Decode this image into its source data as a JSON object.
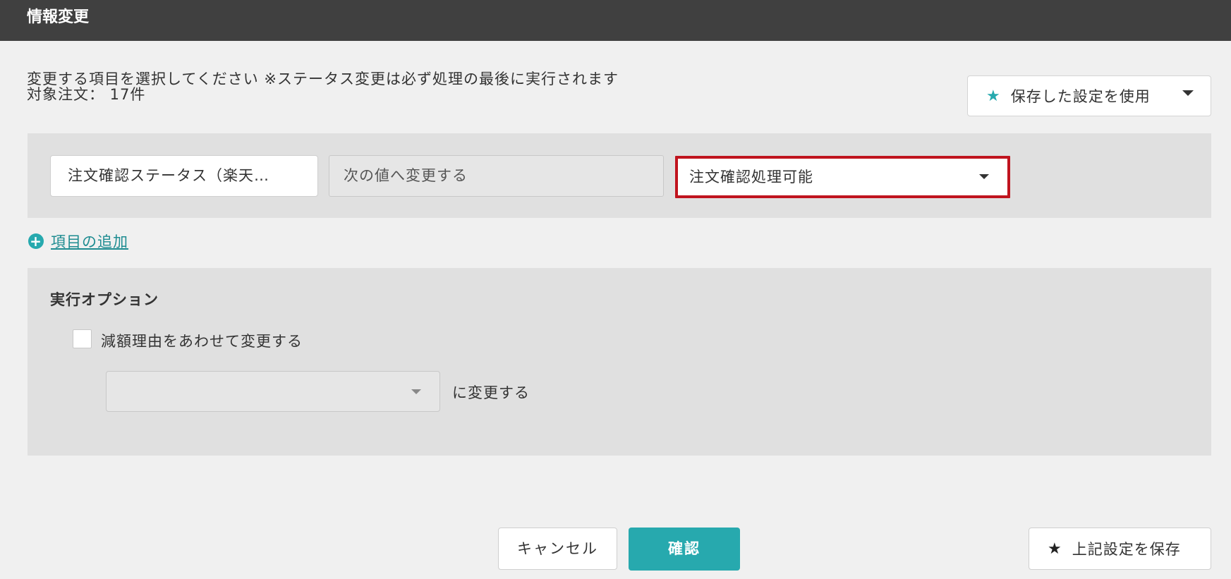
{
  "window": {
    "title": "情報変更"
  },
  "instructions": {
    "line1": "変更する項目を選択してください ※ステータス変更は必ず処理の最後に実行されます",
    "line2": "対象注文： 17件"
  },
  "saved_settings": {
    "label": "保存した設定を使用",
    "icon": "star-icon"
  },
  "field_row": {
    "field": "注文確認ステータス（楽天…",
    "operation": "次の値へ変更する",
    "value": "注文確認処理可能"
  },
  "add_item": {
    "label": "項目の追加",
    "icon": "plus-circle-icon"
  },
  "options": {
    "title": "実行オプション",
    "checkbox_label": "減額理由をあわせて変更する",
    "checkbox_checked": false,
    "reason_value": "",
    "reason_suffix": "に変更する"
  },
  "footer": {
    "cancel": "キャンセル",
    "confirm": "確認",
    "save": "上記設定を保存"
  },
  "colors": {
    "accent": "#27a9ae",
    "titlebar": "#404040",
    "highlight_border": "#c0141e"
  }
}
